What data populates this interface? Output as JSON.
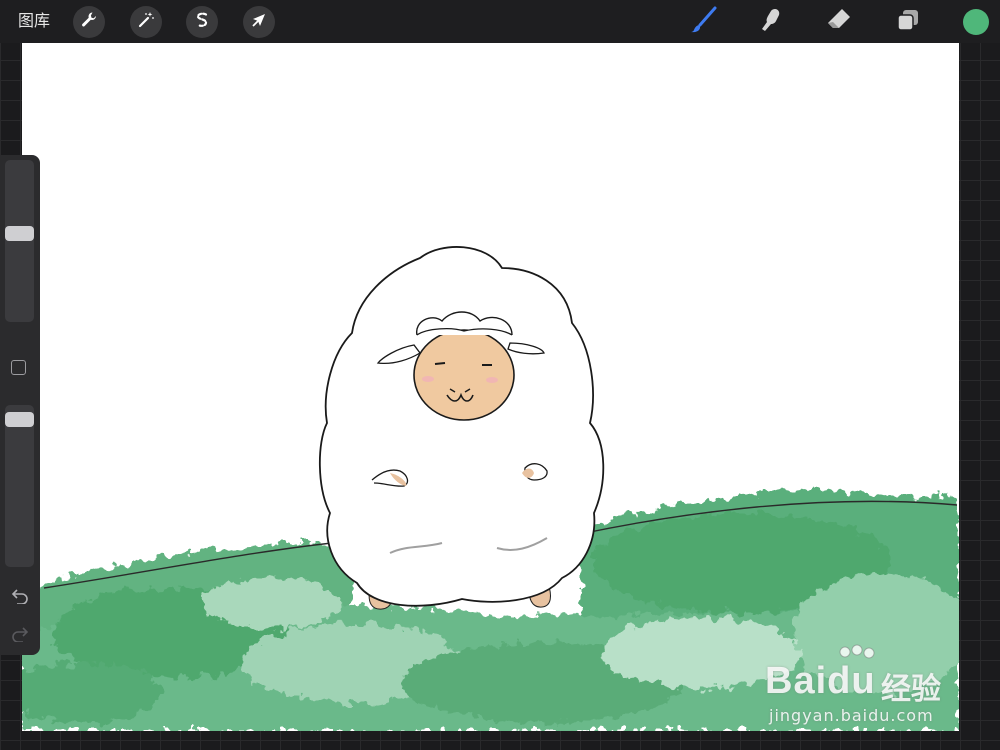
{
  "toolbar": {
    "gallery_label": "图库",
    "left_tools": [
      {
        "name": "actions",
        "icon": "wrench-icon"
      },
      {
        "name": "adjustments",
        "icon": "magic-wand-icon"
      },
      {
        "name": "selection",
        "icon": "selection-s-icon"
      },
      {
        "name": "transform",
        "icon": "arrow-cursor-icon"
      }
    ],
    "right_tools": [
      {
        "name": "brush",
        "icon": "brush-icon",
        "active": true,
        "color": "#3e7bf0"
      },
      {
        "name": "smudge",
        "icon": "smudge-finger-icon"
      },
      {
        "name": "eraser",
        "icon": "eraser-icon"
      },
      {
        "name": "layers",
        "icon": "layers-icon"
      }
    ],
    "current_color": "#4fb77a"
  },
  "sidebar": {
    "brush_size_level": 0.55,
    "opacity_level": 0.05,
    "modify_button_icon": "square-icon",
    "undo_icon": "undo-icon",
    "redo_icon": "redo-icon"
  },
  "canvas": {
    "artwork": "sheep-on-grass-drawing",
    "grass_color": "#4fa86e"
  },
  "watermark": {
    "brand": "Bai",
    "brand2": "du",
    "cn": "经验",
    "url": "jingyan.baidu.com"
  }
}
